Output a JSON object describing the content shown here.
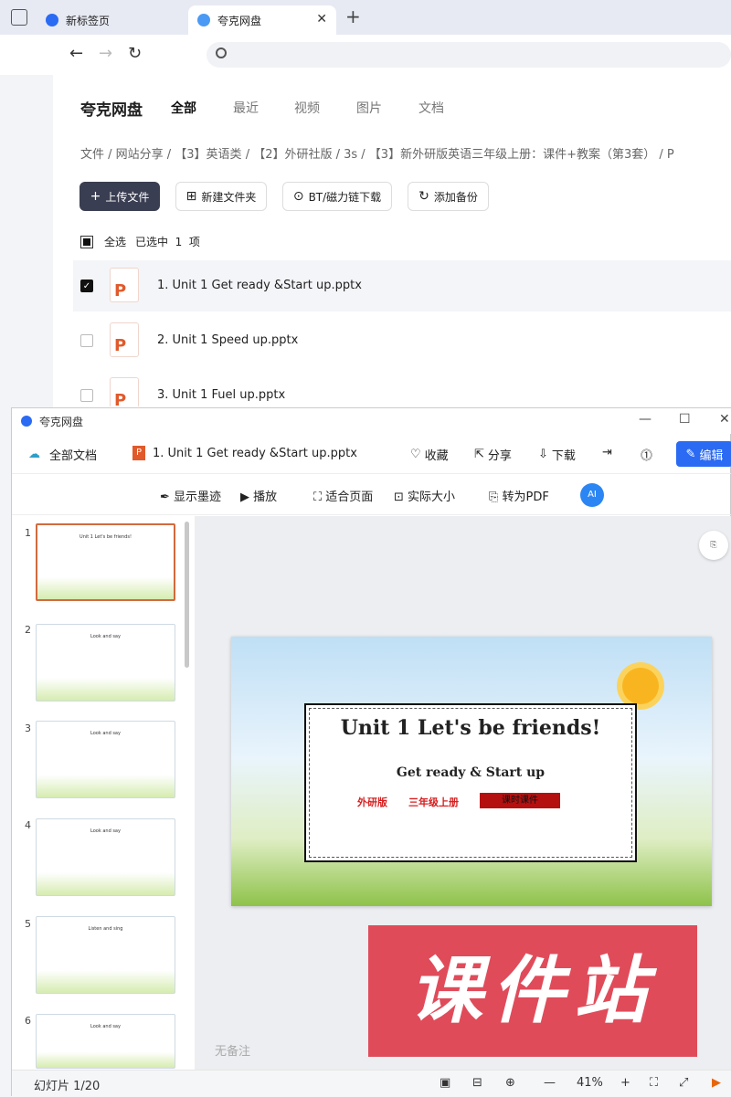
{
  "browser": {
    "tabs": [
      {
        "label": "新标签页",
        "color": "#2b6af3"
      },
      {
        "label": "夸克网盘",
        "color": "#4a9af5"
      }
    ],
    "url": ""
  },
  "drive": {
    "logo": "夸克网盘",
    "tabs": [
      "全部",
      "最近",
      "视频",
      "图片",
      "文档"
    ],
    "breadcrumb": "文件 / 网站分享 / 【3】英语类 / 【2】外研社版 / 3s / 【3】新外研版英语三年级上册：课件+教案（第3套） / P",
    "buttons": {
      "upload": "上传文件",
      "new_folder": "新建文件夹",
      "bt": "BT/磁力链下载",
      "backup": "添加备份"
    },
    "select_all": "全选",
    "selected": "已选中  1  项",
    "files": [
      {
        "name": "1. Unit 1 Get ready &Start up.pptx",
        "checked": true
      },
      {
        "name": "2. Unit 1 Speed up.pptx",
        "checked": false
      },
      {
        "name": "3. Unit 1 Fuel up.pptx",
        "checked": false
      }
    ]
  },
  "viewer": {
    "title": "夸克网盘",
    "all_docs": "全部文档",
    "file": "1. Unit 1 Get ready &Start up.pptx",
    "actions": {
      "favorite": "收藏",
      "share": "分享",
      "download": "下载",
      "edit": "编辑"
    },
    "toolbar": {
      "ink": "显示墨迹",
      "play": "播放",
      "fit": "适合页面",
      "actual": "实际大小",
      "pdf": "转为PDF",
      "ai": "AI"
    },
    "thumbs": [
      {
        "num": "1",
        "title": "Unit 1  Let's be friends!"
      },
      {
        "num": "2",
        "title": "Look and say"
      },
      {
        "num": "3",
        "title": "Look and say"
      },
      {
        "num": "4",
        "title": "Look and say"
      },
      {
        "num": "5",
        "title": "Listen and sing"
      },
      {
        "num": "6",
        "title": "Look and say"
      }
    ],
    "slide": {
      "title": "Unit 1  Let's be friends!",
      "subtitle": "Get ready & Start up",
      "tag1": "外研版",
      "tag2": "三年级上册",
      "tag3": "课时课件"
    },
    "note": "无备注",
    "watermark": "课件站",
    "status": {
      "slides": "幻灯片 1/20",
      "zoom": "41%"
    }
  }
}
